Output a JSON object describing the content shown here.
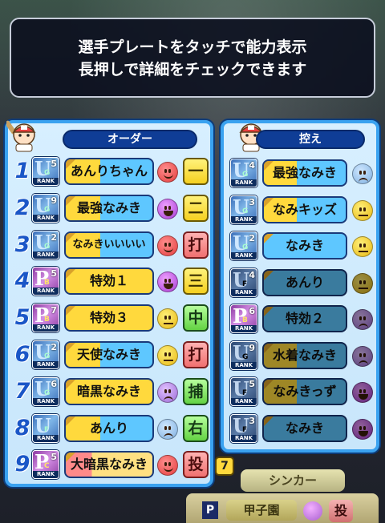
{
  "banner": {
    "line1": "選手プレートをタッチで能力表示",
    "line2": "長押しで詳細をチェックできます"
  },
  "order": {
    "title": "オーダー",
    "players": [
      {
        "num": "1",
        "rank": "UG",
        "rank_level": "5",
        "rank_sub": "",
        "name": "あんりちゃん",
        "face": "great",
        "position": "一",
        "pos_color": "yellow"
      },
      {
        "num": "2",
        "rank": "UG",
        "rank_level": "9",
        "rank_sub": "",
        "name": "最強なみき",
        "face": "best",
        "position": "二",
        "pos_color": "yellow"
      },
      {
        "num": "3",
        "rank": "UG",
        "rank_level": "2",
        "rank_sub": "",
        "name": "なみきいいいい",
        "face": "great",
        "position": "打",
        "pos_color": "pink"
      },
      {
        "num": "4",
        "rank": "PB",
        "rank_level": "5",
        "rank_sub": "B",
        "name": "特効１",
        "face": "best",
        "position": "三",
        "pos_color": "yellow"
      },
      {
        "num": "5",
        "rank": "PB",
        "rank_level": "7",
        "rank_sub": "B",
        "name": "特効３",
        "face": "normal",
        "position": "中",
        "pos_color": "green"
      },
      {
        "num": "6",
        "rank": "UG",
        "rank_level": "2",
        "rank_sub": "",
        "name": "天使なみき",
        "face": "normal",
        "position": "打",
        "pos_color": "pink"
      },
      {
        "num": "7",
        "rank": "UG",
        "rank_level": "6",
        "rank_sub": "",
        "name": "暗黒なみき",
        "face": "bad",
        "position": "捕",
        "pos_color": "green"
      },
      {
        "num": "8",
        "rank": "UF",
        "rank_level": "",
        "rank_sub": "",
        "name": "あんり",
        "face": "worst",
        "position": "右",
        "pos_color": "green"
      },
      {
        "num": "9",
        "rank": "PC",
        "rank_level": "5",
        "rank_sub": "C",
        "name": "大暗黒なみき",
        "face": "great",
        "position": "投",
        "pos_color": "pink"
      }
    ]
  },
  "bench": {
    "title": "控え",
    "players": [
      {
        "rank": "UG",
        "rank_level": "4",
        "name": "最強なみき",
        "face": "worst"
      },
      {
        "rank": "UG",
        "rank_level": "3",
        "name": "なみキッズ",
        "face": "normal"
      },
      {
        "rank": "UG",
        "rank_level": "2",
        "name": "なみき",
        "face": "normal"
      },
      {
        "rank": "UF",
        "rank_level": "4",
        "name": "あんり",
        "face": "normal"
      },
      {
        "rank": "PB",
        "rank_level": "6",
        "name": "特効２",
        "face": "bad"
      },
      {
        "rank": "UG",
        "rank_level": "9",
        "name": "水着なみき",
        "face": "bad"
      },
      {
        "rank": "UF",
        "rank_level": "5",
        "name": "なみきっず",
        "face": "best"
      },
      {
        "rank": "UF",
        "rank_level": "3",
        "name": "なみき",
        "face": "best"
      }
    ]
  },
  "rank_tag": "RANK",
  "bottom": {
    "chip": "7",
    "ability": "シンカー",
    "badge": "P",
    "team": "甲子園",
    "position": "投"
  }
}
